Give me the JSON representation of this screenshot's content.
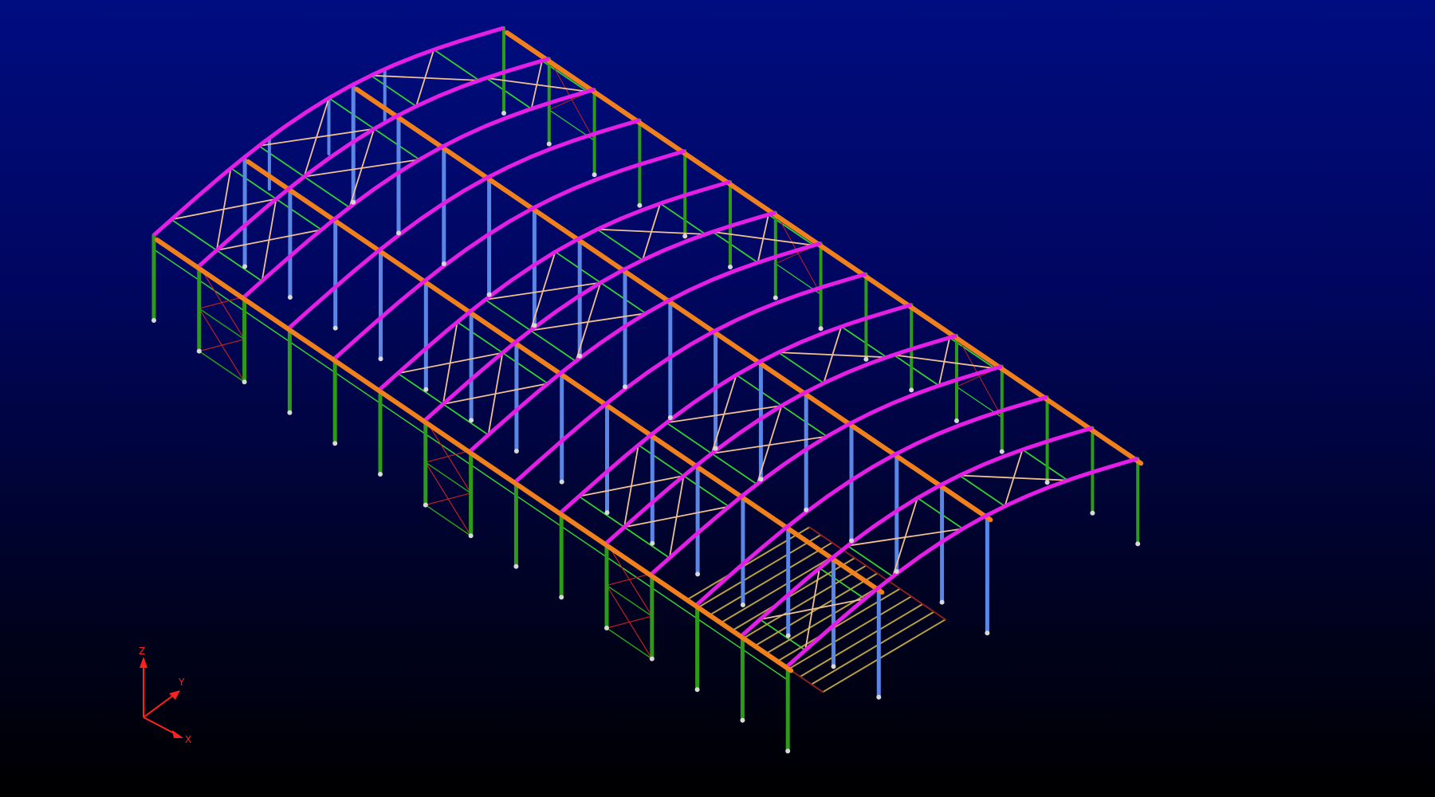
{
  "viewport": {
    "background_top": "#000d80",
    "background_bottom": "#000000"
  },
  "member_colors": {
    "rafter": "#e51ee5",
    "column_frame": "#2e9a1a",
    "column_interior": "#5a86e6",
    "eave_beam": "#f07f1e",
    "bracing_roof": "#f0c090",
    "bracing_green": "#33d033",
    "bracing_wall": "#c02020",
    "floor_joist": "#b8a040"
  },
  "triad": {
    "z_label": "Z",
    "y_label": "Y",
    "x_label": "X",
    "axis_color": "#ff2020"
  }
}
